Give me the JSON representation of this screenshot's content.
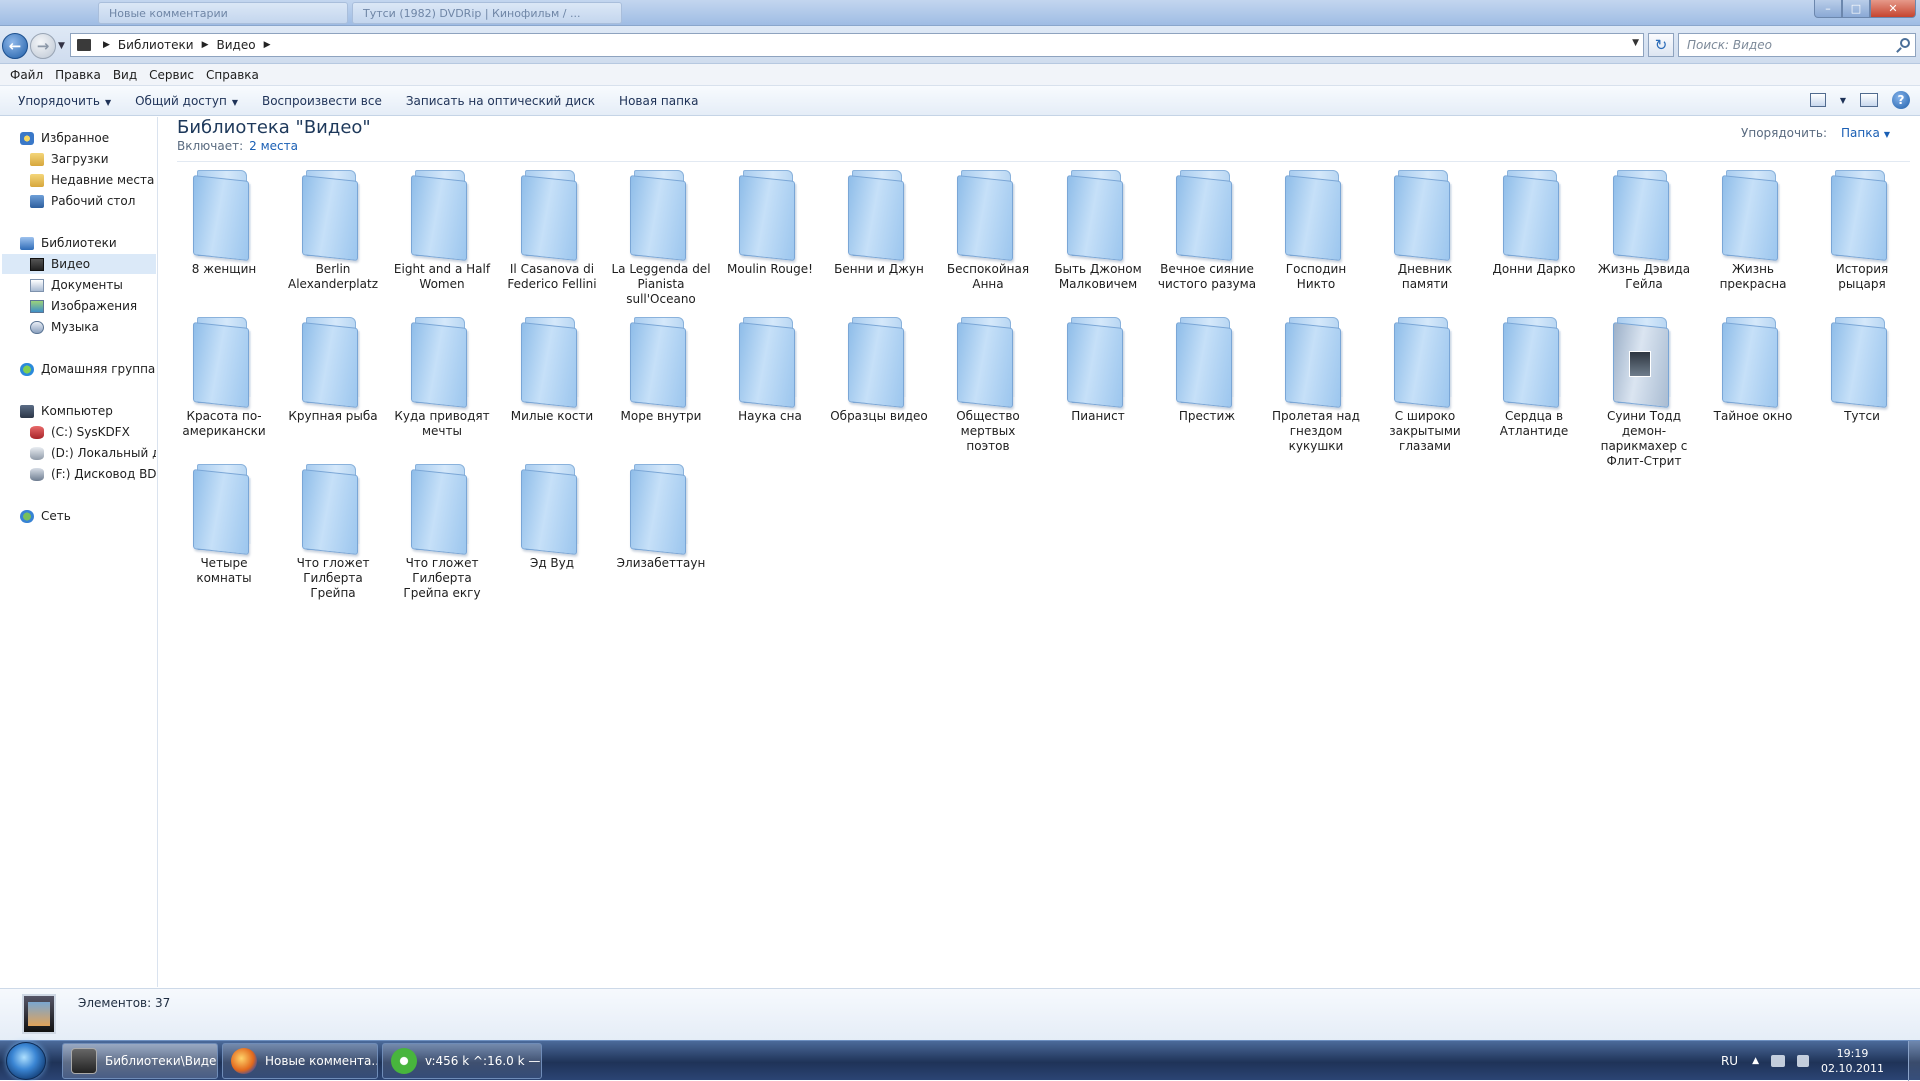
{
  "titlebar": {
    "ghost_tabs": [
      "Новые комментарии",
      "Тутси (1982) DVDRip | Кинофильм / ..."
    ],
    "minimize": "–",
    "maximize": "□",
    "close": "✕"
  },
  "address": {
    "crumbs": [
      "Библиотеки",
      "Видео"
    ],
    "search_placeholder": "Поиск: Видео"
  },
  "menu": [
    "Файл",
    "Правка",
    "Вид",
    "Сервис",
    "Справка"
  ],
  "commands": {
    "organize": "Упорядочить",
    "share": "Общий доступ",
    "play_all": "Воспроизвести все",
    "burn": "Записать на оптический диск",
    "new_folder": "Новая папка"
  },
  "nav": {
    "favorites": "Избранное",
    "downloads": "Загрузки",
    "recent": "Недавние места",
    "desktop": "Рабочий стол",
    "libraries": "Библиотеки",
    "video": "Видео",
    "documents": "Документы",
    "images": "Изображения",
    "music": "Музыка",
    "homegroup": "Домашняя группа",
    "computer": "Компьютер",
    "drive_c": "(C:) SysKDFX",
    "drive_d": "(D:) Локальный диск",
    "drive_f": "(F:) Дисковод BD-ROM",
    "network": "Сеть"
  },
  "library": {
    "title": "Библиотека \"Видео\"",
    "includes_label": "Включает:",
    "includes_link": "2 места",
    "arrange_label": "Упорядочить:",
    "arrange_value": "Папка"
  },
  "folders": [
    "8 женщин",
    "Berlin Alexanderplatz",
    "Eight and a Half Women",
    "Il Casanova di Federico Fellini",
    "La Leggenda del Pianista sull'Oceano",
    "Moulin Rouge!",
    "Бенни и Джун",
    "Беспокойная Анна",
    "Быть Джоном Малковичем",
    "Вечное сияние чистого разума",
    "Господин Никто",
    "Дневник памяти",
    "Донни Дарко",
    "Жизнь Дэвида Гейла",
    "Жизнь прекрасна",
    "История рыцаря",
    "Красота по-американски",
    "Крупная рыба",
    "Куда приводят мечты",
    "Милые кости",
    "Море внутри",
    "Наука сна",
    "Образцы видео",
    "Общество мертвых поэтов",
    "Пианист",
    "Престиж",
    "Пролетая над гнездом кукушки",
    "С широко закрытыми глазами",
    "Сердца в Атлантиде",
    "Суини Тодд демон-парикмахер с Флит-Стрит",
    "Тайное окно",
    "Тутси",
    "Четыре комнаты",
    "Что гложет Гилберта Грейпа",
    "Что гложет Гилберта Грейпа екгу",
    "Эд Вуд",
    "Элизабеттаун"
  ],
  "status": {
    "count": "Элементов: 37"
  },
  "taskbar": {
    "explorer": "Библиотеки\\Видео",
    "firefox": "Новые коммента...",
    "utorrent": "v:456 k ^:16.0 k —...",
    "lang": "RU",
    "time": "19:19",
    "date": "02.10.2011"
  }
}
